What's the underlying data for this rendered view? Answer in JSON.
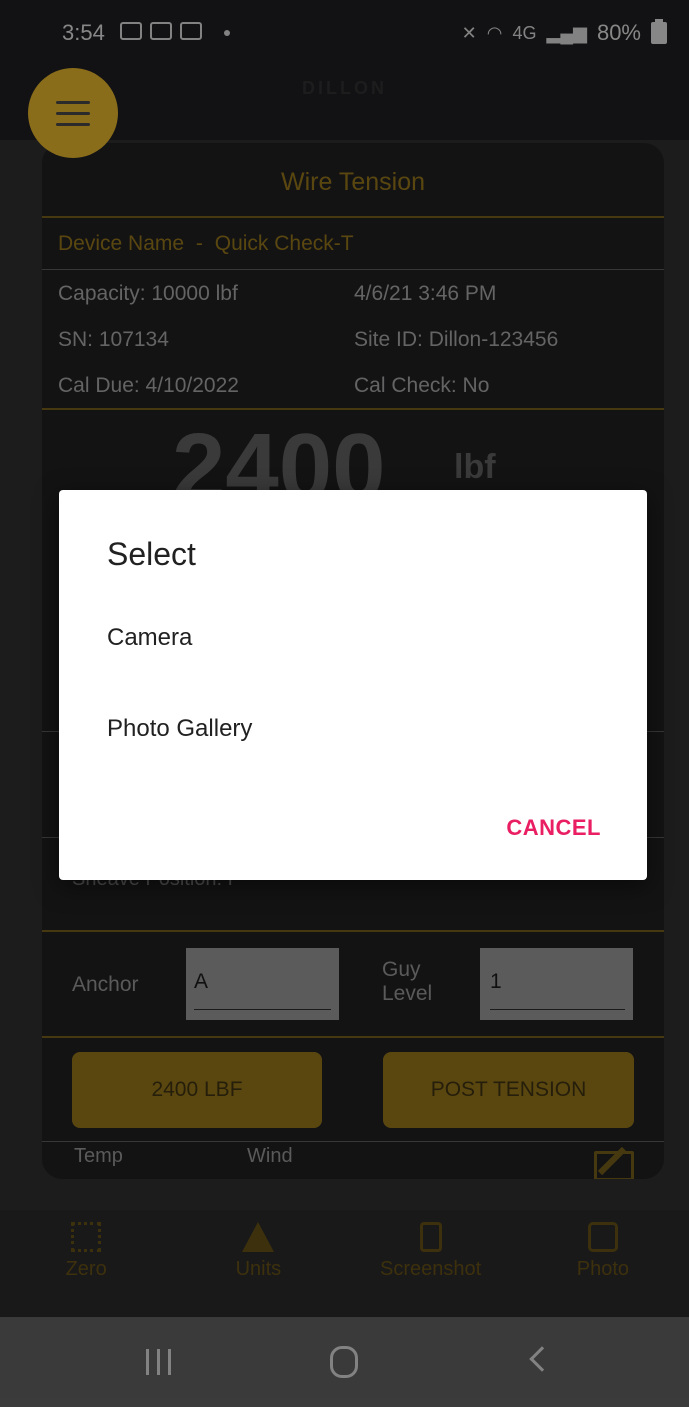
{
  "status_bar": {
    "time": "3:54",
    "network": "4G",
    "battery": "80%"
  },
  "header": {
    "brand": "DILLON",
    "menu_icon": "hamburger-menu-icon"
  },
  "card": {
    "title": "Wire Tension",
    "device_label": "Device Name",
    "device_separator": "-",
    "device_name": "Quick Check-T",
    "capacity": "Capacity: 10000 lbf",
    "timestamp": "4/6/21 3:46 PM",
    "sn": "SN: 107134",
    "site_id": "Site ID: Dillon-123456",
    "cal_due": "Cal Due:  4/10/2022",
    "cal_check": "Cal Check: No",
    "reading_value": "2400",
    "reading_unit": "lbf",
    "sheave_position": "Sheave Position:  P",
    "anchor_label": "Anchor",
    "anchor_value": "A",
    "guy_level_label_1": "Guy",
    "guy_level_label_2": "Level",
    "guy_level_value": "1",
    "tension_button": "2400 LBF",
    "post_button": "POST TENSION",
    "temp_label": "Temp",
    "wind_label": "Wind"
  },
  "bottom_nav": {
    "items": [
      {
        "label": "Zero",
        "icon": "zero-icon"
      },
      {
        "label": "Units",
        "icon": "weight-icon"
      },
      {
        "label": "Screenshot",
        "icon": "phone-screenshot-icon"
      },
      {
        "label": "Photo",
        "icon": "camera-icon"
      }
    ]
  },
  "dialog": {
    "title": "Select",
    "options": [
      "Camera",
      "Photo Gallery"
    ],
    "cancel": "CANCEL"
  },
  "colors": {
    "accent_gold": "#8a6d1a",
    "dialog_action": "#e91e63"
  }
}
